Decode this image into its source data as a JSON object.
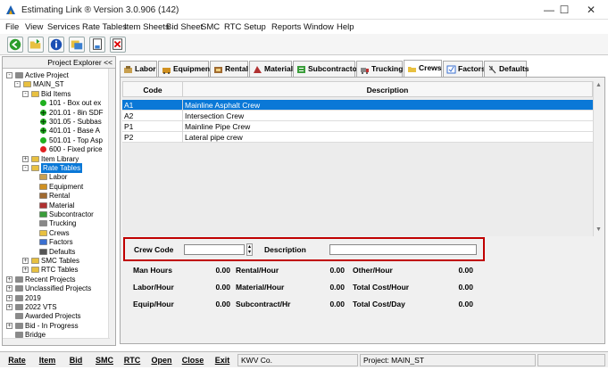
{
  "window": {
    "title": "Estimating Link ® Version  3.0.906 (142)",
    "minimize": "—",
    "maximize": "☐",
    "close": "✕"
  },
  "menu": [
    "File",
    "View",
    "Services",
    "Rate Tables",
    "Item Sheets",
    "Bid Sheet",
    "SMC",
    "RTC",
    "Setup",
    "Reports",
    "Window",
    "Help"
  ],
  "toolbar_icons": [
    "back-arrow-icon",
    "open-folder-icon",
    "info-icon",
    "folders-icon",
    "document-icon",
    "close-document-icon"
  ],
  "explorer": {
    "header": "Project Explorer <<",
    "tree": [
      {
        "label": "Active Project",
        "exp": "-",
        "icon": "project-icon"
      },
      {
        "label": "MAIN_ST",
        "exp": "-",
        "icon": "folder-icon"
      },
      {
        "label": "Bid Items",
        "exp": "-",
        "icon": "folder-icon"
      },
      {
        "label": "101 - Box out ex",
        "icon": "green-dot-icon"
      },
      {
        "label": "201.01 - 8in SDF",
        "icon": "green-cross-icon"
      },
      {
        "label": "301.05 - Subbas",
        "icon": "green-cross-icon"
      },
      {
        "label": "401.01 - Base A",
        "icon": "green-cross-icon"
      },
      {
        "label": "501.01 - Top Asp",
        "icon": "green-dot-icon"
      },
      {
        "label": "600 - Fixed price",
        "icon": "red-dot-icon"
      },
      {
        "label": "Item Library",
        "exp": "+",
        "icon": "folder-icon"
      },
      {
        "label": "Rate Tables",
        "exp": "-",
        "icon": "folder-icon",
        "selected": true
      },
      {
        "label": "Labor",
        "icon": "labor-icon"
      },
      {
        "label": "Equipment",
        "icon": "equipment-icon"
      },
      {
        "label": "Rental",
        "icon": "rental-icon"
      },
      {
        "label": "Material",
        "icon": "material-icon"
      },
      {
        "label": "Subcontractor",
        "icon": "subcontractor-icon"
      },
      {
        "label": "Trucking",
        "icon": "trucking-icon"
      },
      {
        "label": "Crews",
        "icon": "crews-icon"
      },
      {
        "label": "Factors",
        "icon": "factors-icon"
      },
      {
        "label": "Defaults",
        "icon": "defaults-icon"
      },
      {
        "label": "SMC Tables",
        "exp": "+",
        "icon": "folder-icon"
      },
      {
        "label": "RTC Tables",
        "exp": "+",
        "icon": "folder-icon"
      },
      {
        "label": "Recent Projects",
        "exp": "+",
        "icon": "project-icon"
      },
      {
        "label": "Unclassified Projects",
        "exp": "+",
        "icon": "project-icon"
      },
      {
        "label": "2019",
        "exp": "+",
        "icon": "project-icon"
      },
      {
        "label": "2022 VTS",
        "exp": "+",
        "icon": "project-icon"
      },
      {
        "label": "Awarded Projects",
        "icon": "project-icon"
      },
      {
        "label": "Bid - In Progress",
        "exp": "+",
        "icon": "project-icon"
      },
      {
        "label": "Bridge",
        "icon": "project-icon"
      }
    ]
  },
  "tabs": [
    "Labor",
    "Equipment",
    "Rental",
    "Material",
    "Subcontractor",
    "Trucking",
    "Crews",
    "Factors",
    "Defaults"
  ],
  "active_tab": "Crews",
  "grid": {
    "headers": [
      "Code",
      "Description"
    ],
    "rows": [
      {
        "code": "A1",
        "description": "Mainline Asphalt Crew",
        "selected": true
      },
      {
        "code": "A2",
        "description": "Intersection Crew"
      },
      {
        "code": "P1",
        "description": "Mainline Pipe Crew"
      },
      {
        "code": "P2",
        "description": "Lateral pipe crew"
      }
    ]
  },
  "crew_form": {
    "crew_code_label": "Crew Code",
    "crew_code_value": "",
    "description_label": "Description",
    "description_value": ""
  },
  "summary": {
    "col1": [
      {
        "label": "Man Hours",
        "value": "0.00"
      },
      {
        "label": "Labor/Hour",
        "value": "0.00"
      },
      {
        "label": "Equip/Hour",
        "value": "0.00"
      }
    ],
    "col2": [
      {
        "label": "Rental/Hour",
        "value": "0.00"
      },
      {
        "label": "Material/Hour",
        "value": "0.00"
      },
      {
        "label": "Subcontract/Hr",
        "value": "0.00"
      }
    ],
    "col3": [
      {
        "label": "Other/Hour",
        "value": "0.00"
      },
      {
        "label": "Total Cost/Hour",
        "value": "0.00"
      },
      {
        "label": "Total Cost/Day",
        "value": "0.00"
      }
    ]
  },
  "statusbar": {
    "buttons": [
      "Rate",
      "Item",
      "Bid",
      "SMC",
      "RTC",
      "Open",
      "Close",
      "Exit"
    ],
    "company": "KWV Co.",
    "project": "Project: MAIN_ST"
  }
}
